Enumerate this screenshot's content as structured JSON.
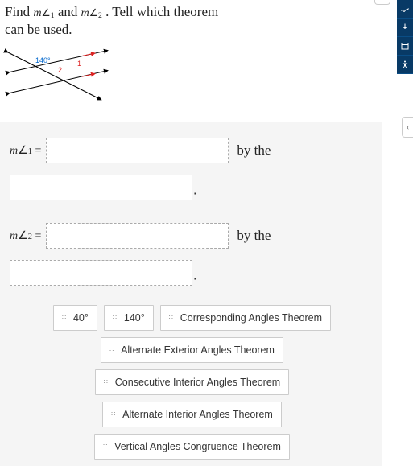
{
  "prompt": {
    "pre": "Find ",
    "m1": "m∠1",
    "mid": " and ",
    "m2": "m∠2",
    "post": " . Tell which theorem can be used."
  },
  "figure": {
    "given_angle_label": "140°",
    "angle1_label": "1",
    "angle2_label": "2"
  },
  "answers": {
    "row1": {
      "label_var": "m∠1",
      "eq": " = ",
      "suffix": "by the"
    },
    "row2": {
      "label_var": "m∠2",
      "eq": " = ",
      "suffix": "by the"
    }
  },
  "choices": [
    "40°",
    "140°",
    "Corresponding Angles Theorem",
    "Alternate Exterior Angles Theorem",
    "Consecutive Interior Angles Theorem",
    "Alternate Interior Angles Theorem",
    "Vertical Angles Congruence Theorem"
  ],
  "sidebar": {
    "icons": [
      "squiggle",
      "download",
      "calendar",
      "accessibility"
    ]
  },
  "collapse_glyph": "‹"
}
